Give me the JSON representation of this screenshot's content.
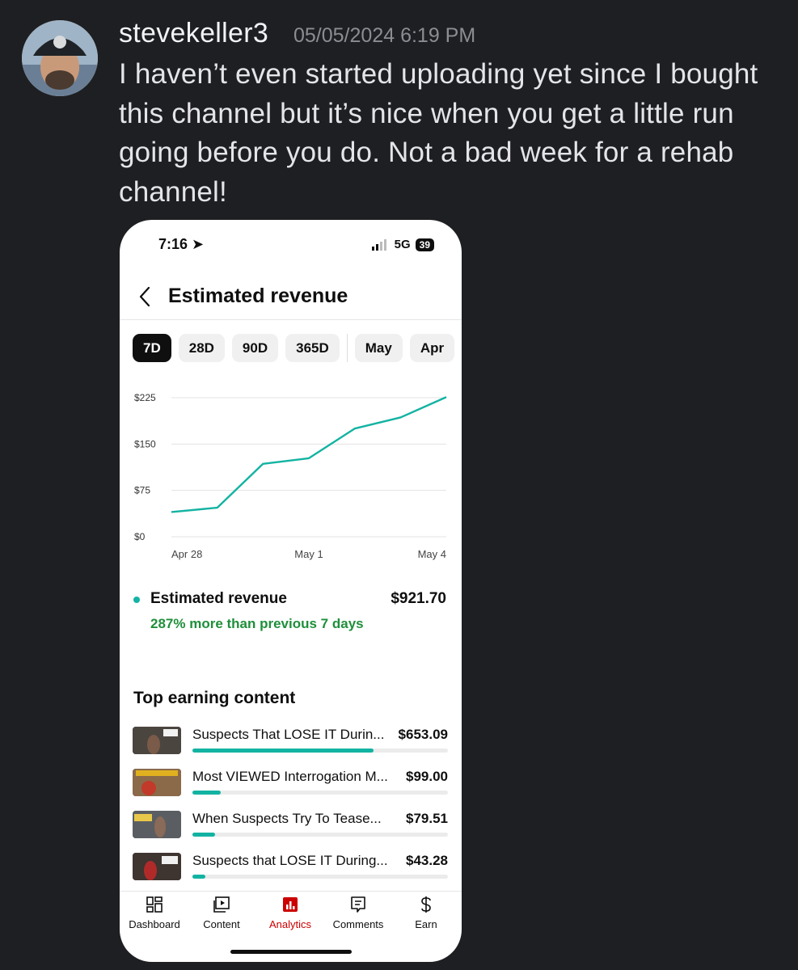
{
  "post": {
    "username": "stevekeller3",
    "timestamp": "05/05/2024 6:19 PM",
    "message": "I haven’t even started uploading yet since I bought this channel but it’s nice when you get a little run going before you do. Not a bad week for a rehab channel!"
  },
  "phone": {
    "status": {
      "time": "7:16",
      "network": "5G",
      "battery": "39"
    },
    "header": {
      "title": "Estimated revenue"
    },
    "chips": [
      "7D",
      "28D",
      "90D",
      "365D",
      "May",
      "Apr"
    ],
    "active_chip": "7D",
    "metric": {
      "label": "Estimated revenue",
      "value": "$921.70",
      "change": "287% more than previous 7 days"
    },
    "top_content": {
      "title": "Top earning content",
      "items": [
        {
          "title": "Suspects That LOSE IT Durin...",
          "value": "$653.09",
          "fraction": 0.71
        },
        {
          "title": "Most VIEWED Interrogation M...",
          "value": "$99.00",
          "fraction": 0.11
        },
        {
          "title": "When Suspects Try To Tease...",
          "value": "$79.51",
          "fraction": 0.09
        },
        {
          "title": "Suspects that LOSE IT During...",
          "value": "$43.28",
          "fraction": 0.05
        }
      ]
    },
    "nav": [
      {
        "label": "Dashboard",
        "icon": "dashboard-icon"
      },
      {
        "label": "Content",
        "icon": "content-icon"
      },
      {
        "label": "Analytics",
        "icon": "analytics-icon"
      },
      {
        "label": "Comments",
        "icon": "comments-icon"
      },
      {
        "label": "Earn",
        "icon": "earn-icon"
      }
    ],
    "active_nav": "Analytics"
  },
  "colors": {
    "accent": "#13b3a2",
    "positive": "#1f8f3a",
    "active_nav": "#cc0000"
  },
  "chart_data": {
    "type": "line",
    "x": [
      "Apr 28",
      "Apr 29",
      "Apr 30",
      "May 1",
      "May 2",
      "May 3",
      "May 4"
    ],
    "series": [
      {
        "values": [
          40,
          47,
          118,
          127,
          175,
          193,
          226
        ]
      }
    ],
    "ylim": [
      0,
      225
    ],
    "yticks": [
      "$0",
      "$75",
      "$150",
      "$225"
    ],
    "xtick_labels": [
      "Apr 28",
      "May 1",
      "May 4"
    ],
    "grid": true
  }
}
